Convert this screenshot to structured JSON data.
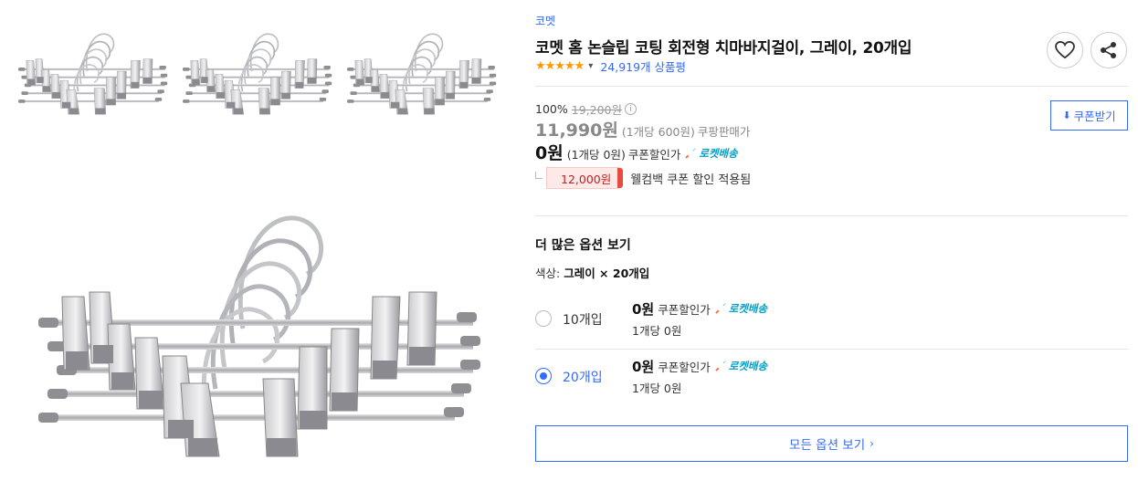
{
  "product": {
    "brand": "코멧",
    "title": "코멧 홈 논슬립 코팅 회전형 치마바지걸이, 그레이, 20개입",
    "rating_stars": "★★★★★",
    "review_count": "24,919개 상품평"
  },
  "price": {
    "discount_percent": "100%",
    "original_price": "19,200원",
    "sale_price": "11,990원",
    "sale_unit_price": "(1개당 600원)",
    "sale_label": "쿠팡판매가",
    "coupon_price": "0원",
    "coupon_unit_price": "(1개당 0원)",
    "coupon_label": "쿠폰할인가",
    "rocket_label": "로켓배송",
    "welcome_coupon_amount": "12,000원",
    "welcome_coupon_text": "웰컴백 쿠폰 할인 적용됨",
    "coupon_button_label": "쿠폰받기"
  },
  "options": {
    "section_title": "더 많은 옵션 보기",
    "current_label": "색상:",
    "current_value": "그레이 × 20개입",
    "items": [
      {
        "name": "10개입",
        "price": "0원",
        "price_label": "쿠폰할인가",
        "rocket": "로켓배송",
        "unit": "1개당 0원",
        "selected": false
      },
      {
        "name": "20개입",
        "price": "0원",
        "price_label": "쿠폰할인가",
        "rocket": "로켓배송",
        "unit": "1개당 0원",
        "selected": true
      }
    ],
    "all_options_label": "모든 옵션 보기"
  },
  "colors": {
    "accent_blue": "#346aff",
    "star_orange": "#ff9800",
    "rocket_cyan": "#00a0c8",
    "coupon_red": "#e94b3c"
  },
  "icons": {
    "heart": "heart-icon",
    "share": "share-icon",
    "download": "download-icon",
    "rocket": "rocket-icon",
    "info": "info-icon"
  }
}
